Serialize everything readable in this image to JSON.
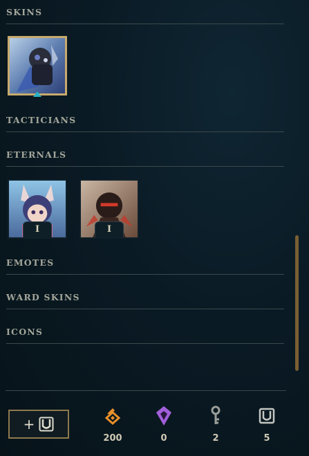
{
  "sections": {
    "skins": "SKINS",
    "tacticians": "TACTICIANS",
    "eternals": "ETERNALS",
    "emotes": "EMOTES",
    "ward_skins": "WARD SKINS",
    "icons": "ICONS"
  },
  "eternal_tiles": [
    {
      "tier": "I"
    },
    {
      "tier": "I"
    }
  ],
  "footer": {
    "add_button_label": "+",
    "currencies": [
      {
        "name": "orange-essence",
        "value": "200",
        "color": "#e8902a"
      },
      {
        "name": "mythic-essence",
        "value": "0",
        "color": "#a15fd9"
      },
      {
        "name": "key",
        "value": "2",
        "color": "#9b9e99"
      },
      {
        "name": "chest",
        "value": "5",
        "color": "#c4c6c0"
      }
    ]
  },
  "colors": {
    "accent_gold": "#c8aa6e",
    "selected_marker": "#2ab3c6",
    "scrollbar": "#7a5f33"
  }
}
